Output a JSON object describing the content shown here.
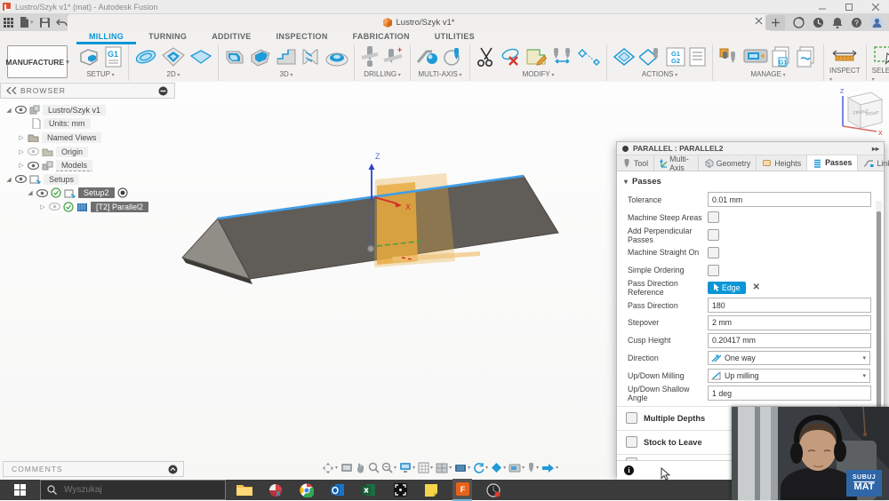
{
  "window": {
    "title": "Lustro/Szyk v1* (mat) - Autodesk Fusion"
  },
  "document_tab": {
    "label": "Lustro/Szyk v1*"
  },
  "ribbon": {
    "workspace": "MANUFACTURE",
    "tabs": [
      {
        "label": "MILLING",
        "active": true
      },
      {
        "label": "TURNING"
      },
      {
        "label": "ADDITIVE"
      },
      {
        "label": "INSPECTION"
      },
      {
        "label": "FABRICATION"
      },
      {
        "label": "UTILITIES"
      }
    ],
    "groups": [
      {
        "label": "SETUP",
        "icons": [
          "setup-icon",
          "operations-doc-icon"
        ]
      },
      {
        "label": "2D",
        "icons": [
          "adaptive2d-icon",
          "pocket2d-icon",
          "face-icon"
        ]
      },
      {
        "label": "3D",
        "icons": [
          "adaptive-clearing-icon",
          "pocket-clearing-icon",
          "steep-shallow-icon",
          "parallel-icon",
          "morphed-spiral-icon"
        ]
      },
      {
        "label": "DRILLING",
        "icons": [
          "drill-icon",
          "thread-mill-icon"
        ]
      },
      {
        "label": "MULTI-AXIS",
        "icons": [
          "swarf-icon",
          "rotary-contour-icon"
        ]
      },
      {
        "label": "MODIFY",
        "icons": [
          "trim-icon",
          "delete-passes-icon",
          "edit-boundary-icon",
          "probe-icon",
          "point-compare-icon"
        ]
      },
      {
        "label": "ACTIONS",
        "icons": [
          "simulate-icon",
          "post-process-icon",
          "g1g2-icon",
          "setup-sheet-icon"
        ]
      },
      {
        "label": "MANAGE",
        "icons": [
          "tool-library-icon",
          "machine-library-icon",
          "post-library-icon",
          "template-library-icon"
        ]
      },
      {
        "label": "INSPECT",
        "icons": [
          "measure-icon"
        ]
      },
      {
        "label": "SELECT",
        "icons": [
          "select-icon"
        ]
      }
    ],
    "g1": "G1",
    "g2": "G2"
  },
  "browser": {
    "header": "BROWSER",
    "items": [
      {
        "label": "Lustro/Szyk v1"
      },
      {
        "label": "Units: mm"
      },
      {
        "label": "Named Views"
      },
      {
        "label": "Origin"
      },
      {
        "label": "Models"
      },
      {
        "label": "Setups"
      },
      {
        "label": "Setup2"
      },
      {
        "label": "[T2] Parallel2"
      }
    ]
  },
  "viewcube": {
    "front": "FRONT",
    "right": "RIGHT",
    "z": "Z",
    "x": "X"
  },
  "scene": {
    "z_label": "Z",
    "x_label": "X"
  },
  "dialog": {
    "title": "PARALLEL : PARALLEL2",
    "tabs": [
      {
        "label": "Tool"
      },
      {
        "label": "Multi-Axis"
      },
      {
        "label": "Geometry"
      },
      {
        "label": "Heights"
      },
      {
        "label": "Passes",
        "active": true
      },
      {
        "label": "Linking"
      }
    ],
    "section_title": "Passes",
    "fields": [
      {
        "label": "Tolerance",
        "value": "0.01 mm"
      },
      {
        "label": "Machine Steep Areas",
        "checked": false
      },
      {
        "label": "Add Perpendicular Passes",
        "checked": false
      },
      {
        "label": "Machine Straight On",
        "checked": false
      },
      {
        "label": "Simple Ordering",
        "checked": false
      },
      {
        "label": "Pass Direction Reference",
        "chip": "Edge"
      },
      {
        "label": "Pass Direction",
        "value": "180"
      },
      {
        "label": "Stepover",
        "value": "2 mm"
      },
      {
        "label": "Cusp Height",
        "value": "0.20417 mm"
      },
      {
        "label": "Direction",
        "value": "One way"
      },
      {
        "label": "Up/Down Milling",
        "value": "Up milling"
      },
      {
        "label": "Up/Down Shallow Angle",
        "value": "1 deg"
      }
    ],
    "sections": [
      {
        "label": "Multiple Depths",
        "checked": false
      },
      {
        "label": "Stock to Leave",
        "checked": false
      }
    ]
  },
  "comments": {
    "label": "COMMENTS"
  },
  "view_toolbar": {
    "icons": [
      "orbit-icon",
      "look-at-icon",
      "pan-icon",
      "zoom-icon",
      "fit-icon",
      "display-settings-icon",
      "grid-icon",
      "viewports-icon",
      "toolpath-display-icon",
      "regenerate-icon",
      "simulate-icon",
      "machine-icon",
      "tool-icon",
      "post-icon"
    ]
  },
  "taskbar": {
    "search_placeholder": "Wyszukaj",
    "icons": [
      "start-button",
      "file-explorer-icon",
      "paint-icon",
      "chrome-icon",
      "outlook-icon",
      "excel-icon",
      "capture-icon",
      "sticky-notes-icon",
      "fusion-icon",
      "recorder-icon"
    ]
  },
  "webcam": {
    "badge_top": "SUBUJ",
    "badge_bottom": "MAT"
  },
  "colors": {
    "accent_blue": "#0a96d6",
    "selection_gray": "#6f6f6f",
    "chip_blue": "#0a96d6",
    "taskbar_bg": "#3b3b3b",
    "badge_blue": "#2f66a7",
    "highlight_edge": "#3f9ee8",
    "plane_orange": "#e8a93e"
  }
}
